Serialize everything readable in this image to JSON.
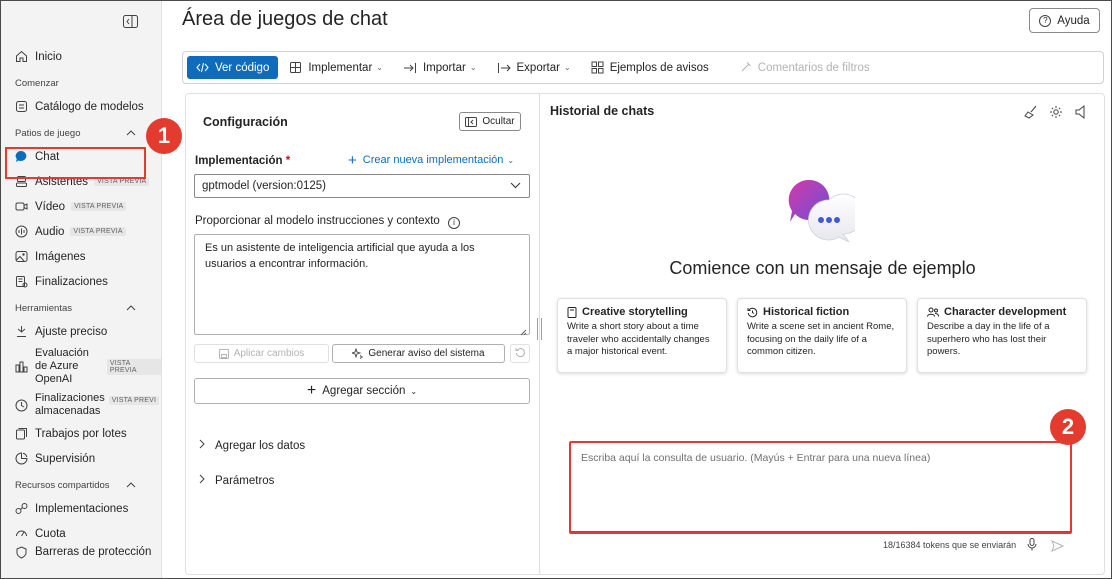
{
  "sidebar": {
    "items": [
      {
        "label": "Inicio",
        "icon": "home-icon"
      },
      {
        "section": "Comenzar"
      },
      {
        "label": "Catálogo de modelos",
        "icon": "catalog-icon"
      },
      {
        "section": "Patios de juego"
      },
      {
        "label": "Chat",
        "icon": "chat-icon"
      },
      {
        "label": "Asistentes",
        "icon": "assistant-icon",
        "badge": "VISTA PREVIA"
      },
      {
        "label": "Vídeo",
        "icon": "video-icon",
        "badge": "VISTA PREVIA"
      },
      {
        "label": "Audio",
        "icon": "audio-icon",
        "badge": "VISTA PREVIA"
      },
      {
        "label": "Imágenes",
        "icon": "images-icon"
      },
      {
        "label": "Finalizaciones",
        "icon": "completions-icon"
      },
      {
        "section": "Herramientas"
      },
      {
        "label": "Ajuste preciso",
        "icon": "fine-tune-icon"
      },
      {
        "label": "Evaluación de Azure OpenAI",
        "icon": "evaluation-icon",
        "badge": "VISTA PREVIA"
      },
      {
        "label": "Finalizaciones almacenadas",
        "icon": "stored-completions-icon",
        "badge": "VISTA PREVIA"
      },
      {
        "label": "Trabajos por lotes",
        "icon": "batch-jobs-icon"
      },
      {
        "label": "Supervisión",
        "icon": "monitoring-icon"
      },
      {
        "section": "Recursos compartidos"
      },
      {
        "label": "Implementaciones",
        "icon": "deployments-icon"
      },
      {
        "label": "Cuota",
        "icon": "quota-icon"
      },
      {
        "label": "Barreras de protección",
        "icon": "guardrails-icon"
      }
    ],
    "nav": {
      "home": "Inicio",
      "sec_start": "Comenzar",
      "catalog": "Catálogo de modelos",
      "sec_playgrounds": "Patios de juego",
      "chat": "Chat",
      "assistants": "Asistentes",
      "video": "Vídeo",
      "audio": "Audio",
      "images": "Imágenes",
      "completions": "Finalizaciones",
      "sec_tools": "Herramientas",
      "finetune": "Ajuste preciso",
      "evaluation_1": "Evaluación",
      "evaluation_2": "de Azure",
      "evaluation_3": "OpenAI",
      "stored_1": "Finalizaciones",
      "stored_2": "almacenadas",
      "batch": "Trabajos por lotes",
      "monitoring": "Supervisión",
      "sec_shared": "Recursos compartidos",
      "deployments": "Implementaciones",
      "quota": "Cuota",
      "guardrails": "Barreras de protección",
      "badge_preview": "VISTA PREVIA",
      "badge_preview_cut": "VISTA PREVI"
    }
  },
  "header": {
    "title": "Área de juegos de chat",
    "help_label": "Ayuda"
  },
  "toolbar": {
    "view_code": "Ver código",
    "deploy": "Implementar",
    "import": "Importar",
    "export": "Exportar",
    "prompt_samples": "Ejemplos de avisos",
    "filter_feedback": "Comentarios de filtros"
  },
  "config": {
    "title": "Configuración",
    "hide_label": "Ocultar",
    "deployment_label": "Implementación",
    "required_mark": "*",
    "create_deployment": "Crear nueva implementación",
    "deployment_value": "gptmodel (version:0125)",
    "instructions_label": "Proporcionar al modelo instrucciones y contexto",
    "instructions_value": "Es un asistente de inteligencia artificial que ayuda a los usuarios a encontrar información.",
    "apply_changes": "Aplicar cambios",
    "generate_system_message": "Generar aviso del sistema",
    "add_section": "Agregar sección",
    "add_data": "Agregar los datos",
    "parameters": "Parámetros"
  },
  "chat": {
    "history_title": "Historial de chats",
    "empty_title": "Comience con un mensaje de ejemplo",
    "cards": [
      {
        "title": "Creative storytelling",
        "text": "Write a short story about a time traveler who accidentally changes a major historical event."
      },
      {
        "title": "Historical fiction",
        "text": "Write a scene set in ancient Rome, focusing on the daily life of a common citizen."
      },
      {
        "title": "Character development",
        "text": "Describe a day in the life of a superhero who has lost their powers."
      }
    ],
    "input_placeholder": "Escriba aquí la consulta de usuario. (Mayús + Entrar para una nueva línea)",
    "token_count": "18/16384 tokens que se enviarán"
  },
  "annotations": {
    "marker_1": "1",
    "marker_2": "2"
  },
  "colors": {
    "accent": "#0f6cbd",
    "highlight": "#e43b2f"
  }
}
